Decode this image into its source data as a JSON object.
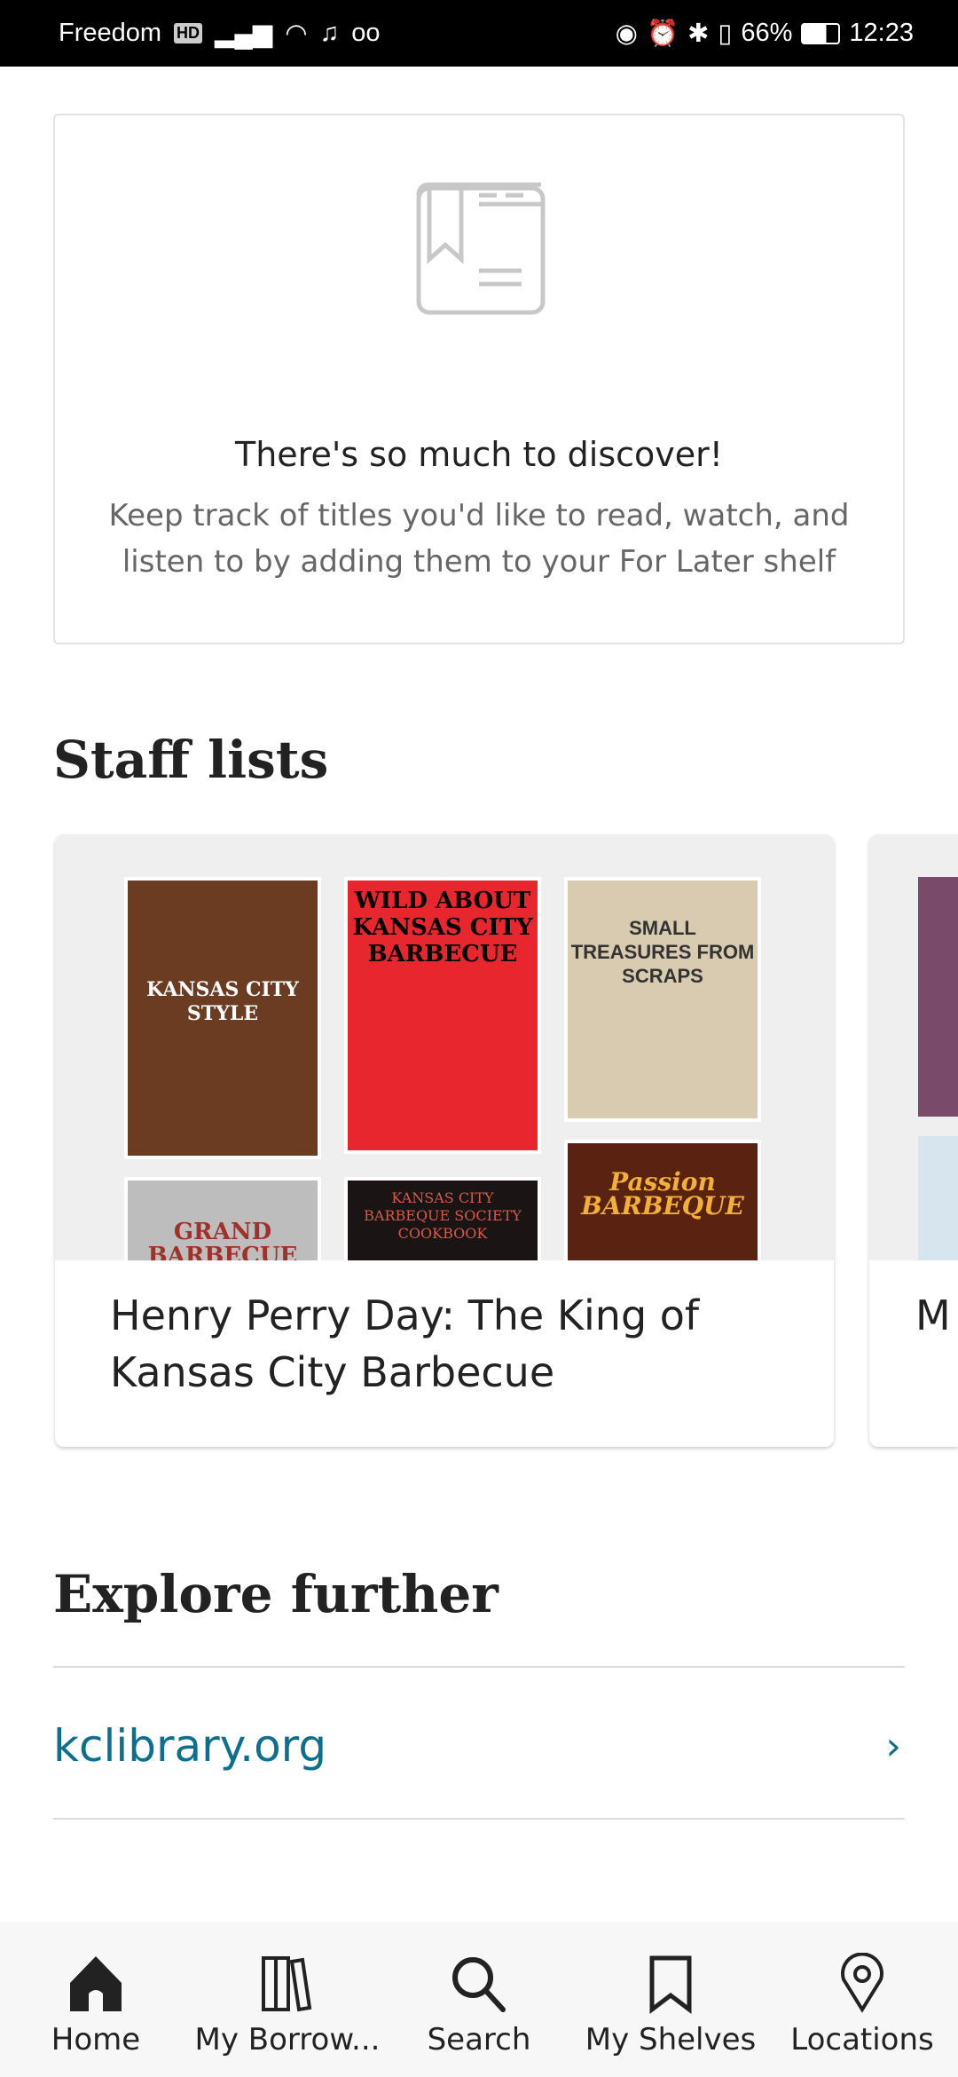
{
  "status_bar": {
    "carrier": "Freedom",
    "hd": "HD",
    "battery": "66%",
    "time": "12:23"
  },
  "empty_state": {
    "icon": "book-bookmark-icon",
    "title": "There's so much to discover!",
    "body": "Keep track of titles you'd like to read, watch, and listen to by adding them to your For Later shelf"
  },
  "staff_lists": {
    "heading": "Staff lists",
    "lists": [
      {
        "title": "Henry Perry Day: The King of Kansas City Barbecue",
        "covers": [
          {
            "text": "KANSAS CITY STYLE",
            "bg": "#6b3b22",
            "fg": "#fff"
          },
          {
            "text": "WILD ABOUT KANSAS CITY BARBECUE",
            "bg": "#e8262d",
            "fg": "#000"
          },
          {
            "text": "SMALL TREASURES FROM SCRAPS",
            "bg": "#d9cbb0",
            "fg": "#333"
          },
          {
            "text": "GRAND BARBECUE",
            "bg": "#bdbdbd",
            "fg": "#a0302a"
          },
          {
            "text": "KANSAS CITY BARBEQUE SOCIETY COOKBOOK",
            "bg": "#1a1414",
            "fg": "#d65a4a"
          },
          {
            "text": "Passion BARBEQUE",
            "bg": "#5a2210",
            "fg": "#f2b136"
          }
        ]
      },
      {
        "title": "M"
      }
    ]
  },
  "explore": {
    "heading": "Explore further",
    "link": "kclibrary.org",
    "link_color": "#0d6f8e"
  },
  "bottom_nav": [
    {
      "label": "Home",
      "icon": "home-icon"
    },
    {
      "label": "My Borrow...",
      "icon": "books-icon"
    },
    {
      "label": "Search",
      "icon": "search-icon"
    },
    {
      "label": "My Shelves",
      "icon": "bookmark-icon"
    },
    {
      "label": "Locations",
      "icon": "location-pin-icon"
    }
  ]
}
